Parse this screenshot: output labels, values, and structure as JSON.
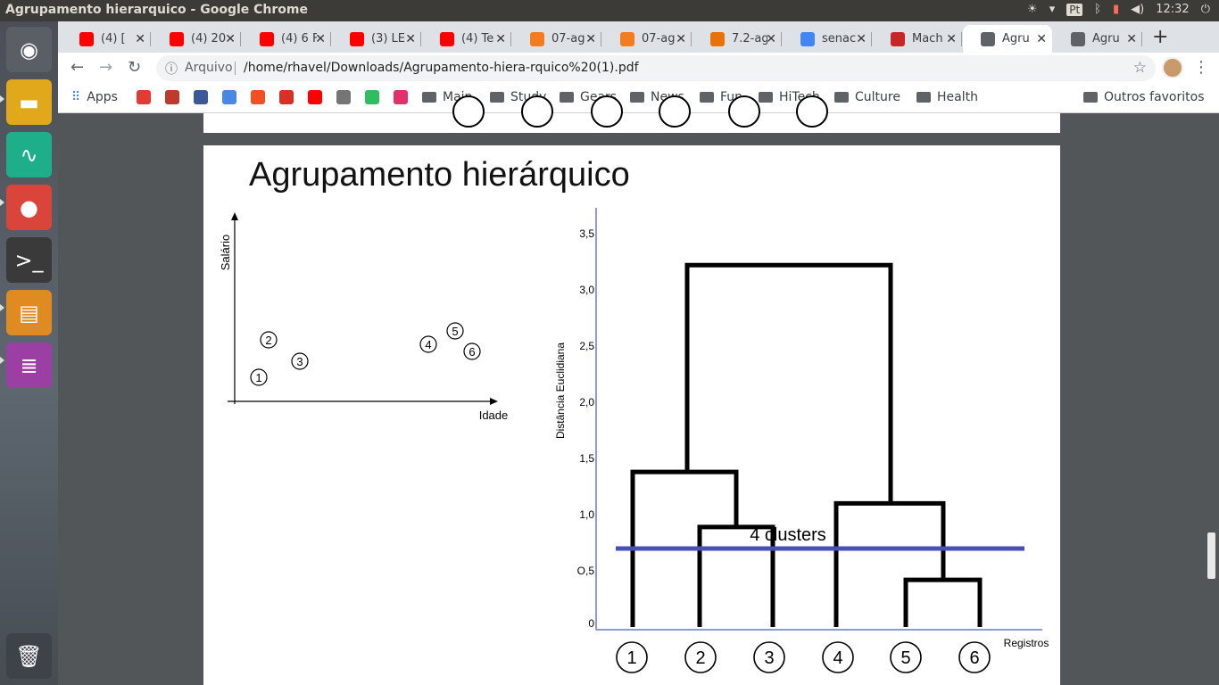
{
  "window": {
    "title": "Agrupamento hierarquico - Google Chrome"
  },
  "tray": {
    "keyboard": "Pt",
    "time": "12:32"
  },
  "launcher": [
    {
      "name": "ubuntu-dash-icon",
      "glyph": "◉",
      "color": "#5a5f66"
    },
    {
      "name": "files-icon",
      "glyph": "▬",
      "color": "#e0a81a"
    },
    {
      "name": "system-monitor-icon",
      "glyph": "∿",
      "color": "#1fae8a"
    },
    {
      "name": "chrome-icon",
      "glyph": "●",
      "color": "#d9453a"
    },
    {
      "name": "terminal-icon",
      "glyph": ">_",
      "color": "#3a3a3a"
    },
    {
      "name": "archive-manager-icon",
      "glyph": "▤",
      "color": "#e08a22"
    },
    {
      "name": "text-editor-icon",
      "glyph": "≣",
      "color": "#9b3fa5"
    },
    {
      "name": "trash-icon",
      "glyph": "🗑",
      "color": "#3e4349"
    }
  ],
  "tabs": [
    {
      "label": "(4) [",
      "fav": "#ff0000"
    },
    {
      "label": "(4) 20",
      "fav": "#ff0000"
    },
    {
      "label": "(4) 6 F",
      "fav": "#ff0000"
    },
    {
      "label": "(3) LE",
      "fav": "#ff0000"
    },
    {
      "label": "(4) Te",
      "fav": "#ff0000"
    },
    {
      "label": "07-ag",
      "fav": "#f47c20"
    },
    {
      "label": "07-ag",
      "fav": "#f47c20"
    },
    {
      "label": "7.2-ag",
      "fav": "#e8710a"
    },
    {
      "label": "senac",
      "fav": "#4285f4"
    },
    {
      "label": "Mach",
      "fav": "#c62828"
    },
    {
      "label": "Agru",
      "fav": "#5f6368",
      "active": true
    },
    {
      "label": "Agru",
      "fav": "#5f6368"
    }
  ],
  "omnibox": {
    "scheme": "Arquivo",
    "url": "/home/rhavel/Downloads/Agrupamento-hiera-rquico%20(1).pdf"
  },
  "bookmarks": {
    "apps": "Apps",
    "icons": [
      "#e53935",
      "#c0392b",
      "#3b5998",
      "#4a86e8",
      "#f25022",
      "#d93025",
      "#ff0000",
      "#757575",
      "#2dbe60",
      "#e1306c"
    ],
    "folders": [
      "Main",
      "Study",
      "Gears",
      "News",
      "Fun",
      "HiTech",
      "Culture",
      "Health"
    ],
    "other": "Outros favoritos"
  },
  "slide": {
    "title": "Agrupamento hierárquico",
    "scatter": {
      "xlabel": "Idade",
      "ylabel": "Salário",
      "points": [
        "1",
        "2",
        "3",
        "4",
        "5",
        "6"
      ]
    },
    "dendrogram": {
      "ylabel": "Distância Euclidiana",
      "xlabel": "Registros",
      "yticks": [
        "0",
        "O,5",
        "1,0",
        "1,5",
        "2,0",
        "2,5",
        "3,0",
        "3,5"
      ],
      "leaves": [
        "1",
        "2",
        "3",
        "4",
        "5",
        "6"
      ],
      "cut_label": "4 clusters",
      "cut_color": "#4a4fb5"
    }
  }
}
